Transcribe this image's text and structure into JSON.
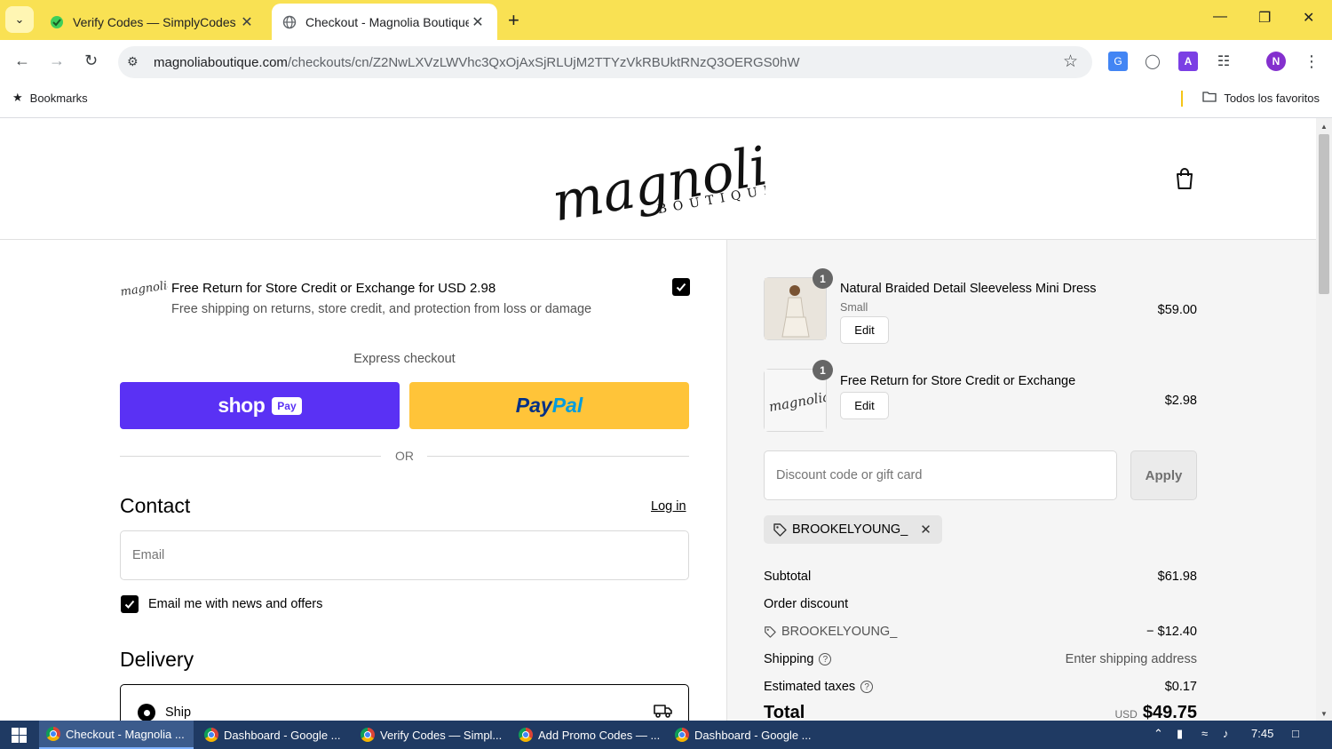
{
  "browser": {
    "tabs": [
      {
        "title": "Verify Codes — SimplyCodes",
        "active": false
      },
      {
        "title": "Checkout - Magnolia Boutique",
        "active": true
      }
    ],
    "url_host": "magnoliaboutique.com",
    "url_path": "/checkouts/cn/Z2NwLXVzLWVhc3QxOjAxSjRLUjM2TTYzVkRBUktRNzQ3OERGS0hW",
    "profile_initial": "N",
    "bookmarks_label": "Bookmarks",
    "all_bookmarks_label": "Todos los favoritos"
  },
  "colors": {
    "tabstrip": "#f9e153",
    "shop_pay": "#5a31f4",
    "paypal": "#ffc439",
    "taskbar": "#1f3a63"
  },
  "header": {
    "logo_text": "magnolia",
    "logo_subtext": "BOUTIQUE"
  },
  "upsell": {
    "logo_text": "magnolia",
    "title": "Free Return for Store Credit or Exchange for USD 2.98",
    "subtitle": "Free shipping on returns, store credit, and protection from loss or damage",
    "checked": true
  },
  "express": {
    "label": "Express checkout",
    "shop_word": "shop",
    "shop_badge": "Pay",
    "paypal_a": "Pay",
    "paypal_b": "Pal",
    "or_label": "OR"
  },
  "contact": {
    "heading": "Contact",
    "login_label": "Log in",
    "email_placeholder": "Email",
    "news_label": "Email me with news and offers",
    "news_checked": true
  },
  "delivery": {
    "heading": "Delivery",
    "ship_label": "Ship"
  },
  "summary": {
    "items": [
      {
        "name": "Natural Braided Detail Sleeveless Mini Dress",
        "variant": "Small",
        "price": "$59.00",
        "qty": "1",
        "edit_label": "Edit"
      },
      {
        "name": "Free Return for Store Credit or Exchange",
        "variant": "",
        "price": "$2.98",
        "qty": "1",
        "edit_label": "Edit",
        "thumb_text": "magnolia"
      }
    ],
    "discount_placeholder": "Discount code or gift card",
    "apply_label": "Apply",
    "applied_code": "BROOKELYOUNG_",
    "subtotal_label": "Subtotal",
    "subtotal_value": "$61.98",
    "order_discount_label": "Order discount",
    "discount_code": "BROOKELYOUNG_",
    "discount_value": "− $12.40",
    "shipping_label": "Shipping",
    "shipping_value": "Enter shipping address",
    "taxes_label": "Estimated taxes",
    "taxes_value": "$0.17",
    "total_label": "Total",
    "total_currency": "USD",
    "total_value": "$49.75"
  },
  "taskbar": {
    "items": [
      {
        "label": "Checkout - Magnolia ...",
        "active": true
      },
      {
        "label": "Dashboard - Google ...",
        "active": false
      },
      {
        "label": "Verify Codes — Simpl...",
        "active": false
      },
      {
        "label": "Add Promo Codes — ...",
        "active": false
      },
      {
        "label": "Dashboard - Google ...",
        "active": false
      }
    ],
    "time": "7:45"
  }
}
